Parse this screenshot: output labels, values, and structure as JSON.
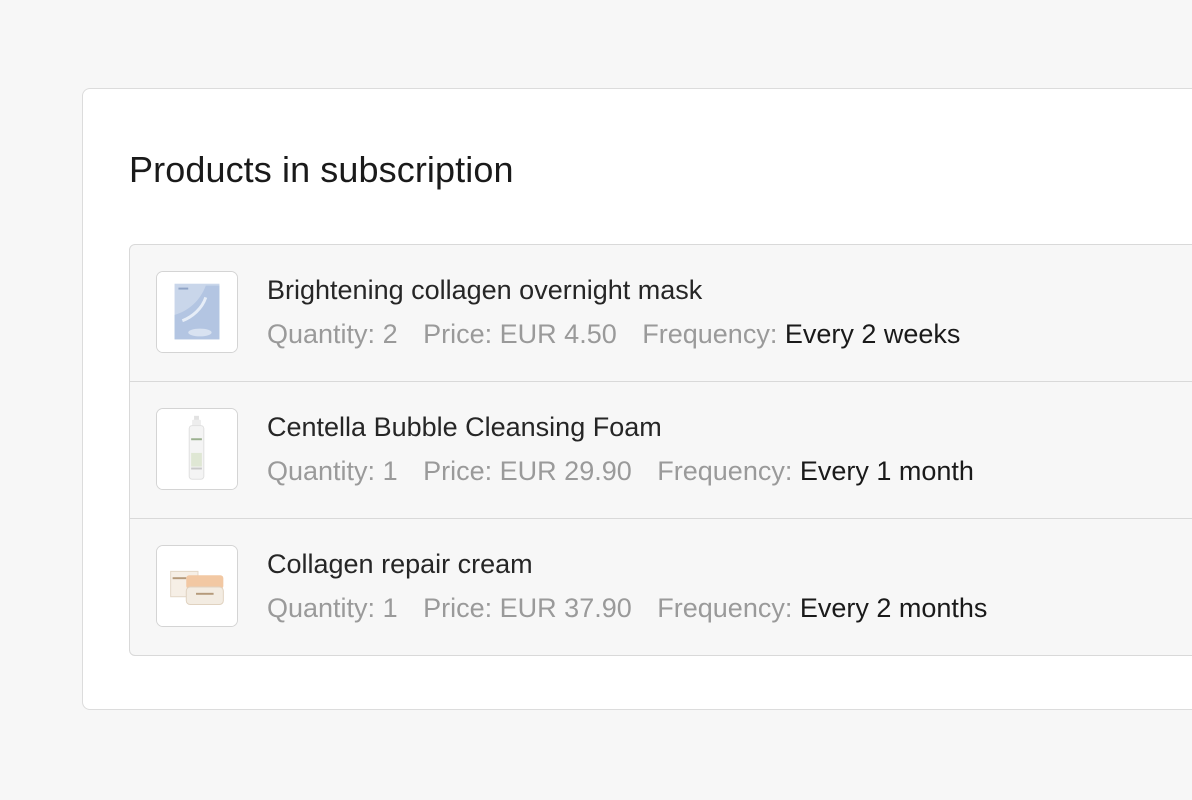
{
  "section": {
    "title": "Products in subscription"
  },
  "labels": {
    "quantity": "Quantity:",
    "price": "Price:",
    "frequency": "Frequency:"
  },
  "products": [
    {
      "name": "Brightening collagen overnight mask",
      "quantity": "2",
      "price": "EUR 4.50",
      "frequency": "Every 2 weeks",
      "image_icon": "sheet-mask-icon"
    },
    {
      "name": "Centella Bubble Cleansing Foam",
      "quantity": "1",
      "price": "EUR 29.90",
      "frequency": "Every 1 month",
      "image_icon": "foam-bottle-icon"
    },
    {
      "name": "Collagen repair cream",
      "quantity": "1",
      "price": "EUR 37.90",
      "frequency": "Every 2 months",
      "image_icon": "cream-jar-icon"
    }
  ],
  "colors": {
    "page_background": "#f7f7f7",
    "card_background": "#ffffff",
    "list_background": "#f7f7f7",
    "muted_text": "#9a9a9a",
    "primary_text": "#1a1a1a",
    "border": "#d9d9d9"
  }
}
